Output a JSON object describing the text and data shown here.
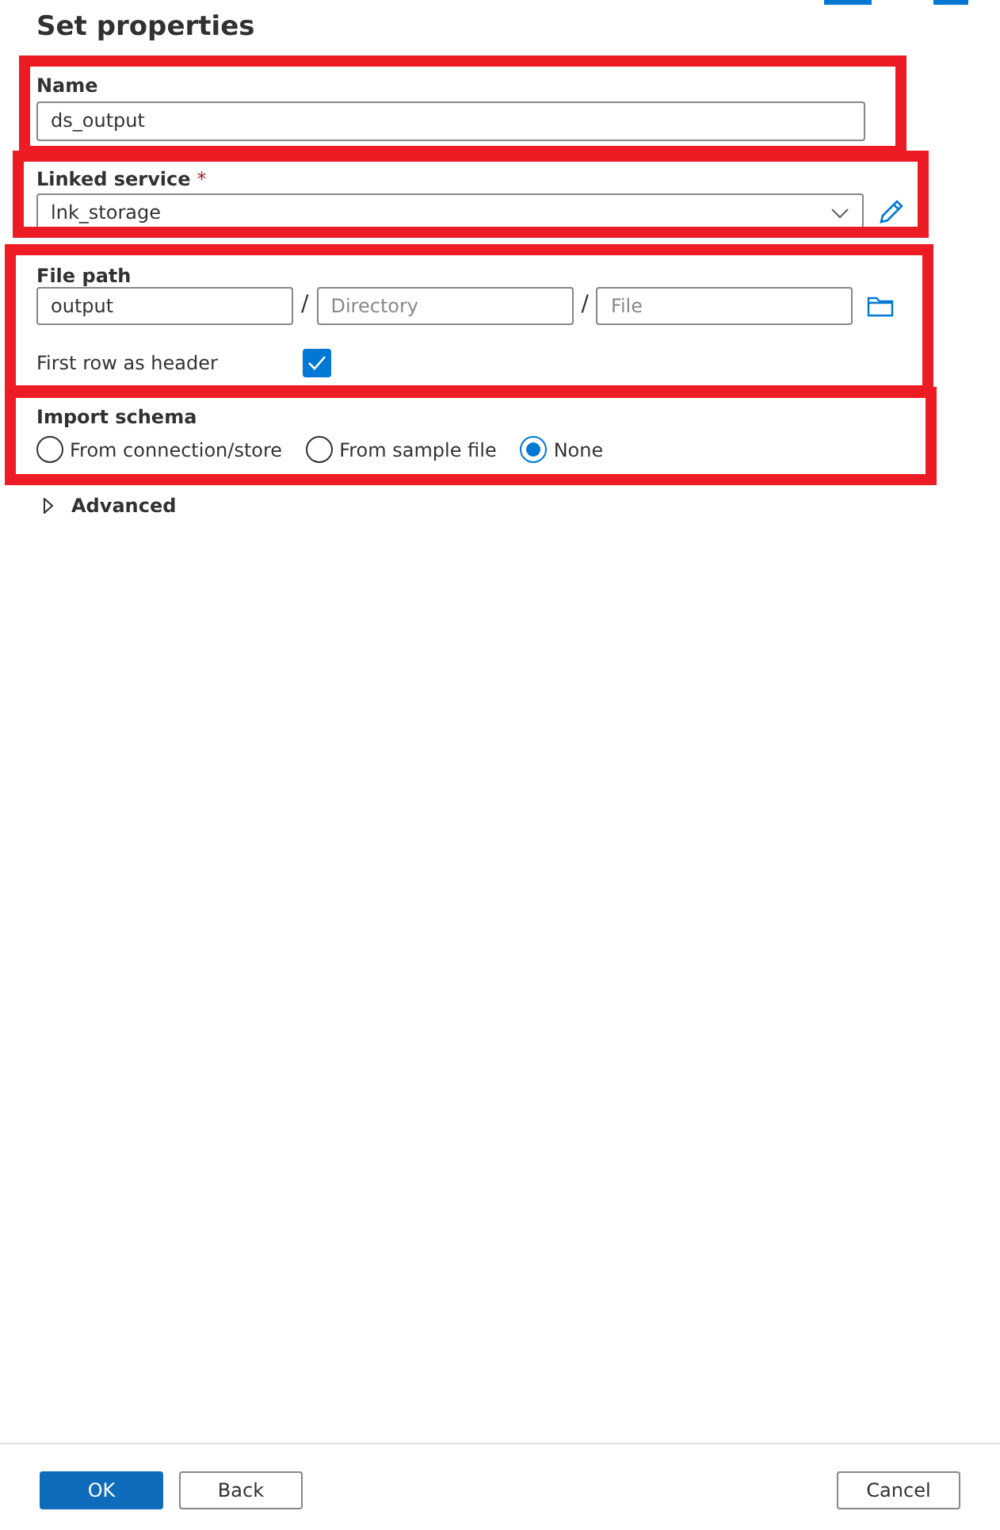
{
  "title": "Set properties",
  "name_field": {
    "label": "Name",
    "value": "ds_output"
  },
  "linked_service": {
    "label": "Linked service",
    "required_mark": "*",
    "value": "lnk_storage"
  },
  "file_path": {
    "label": "File path",
    "container": {
      "value": "output"
    },
    "separators": [
      "/",
      "/"
    ],
    "directory": {
      "placeholder": "Directory"
    },
    "file": {
      "placeholder": "File"
    }
  },
  "first_row_as_header": {
    "label": "First row as header",
    "checked": true
  },
  "import_schema": {
    "label": "Import schema",
    "options": [
      {
        "label": "From connection/store",
        "selected": false
      },
      {
        "label": "From sample file",
        "selected": false
      },
      {
        "label": "None",
        "selected": true
      }
    ]
  },
  "advanced": {
    "label": "Advanced",
    "expanded": false
  },
  "buttons": [
    {
      "label": "OK",
      "kind": "primary"
    },
    {
      "label": "Back",
      "kind": "secondary"
    },
    {
      "label": "Cancel",
      "kind": "secondary"
    }
  ]
}
